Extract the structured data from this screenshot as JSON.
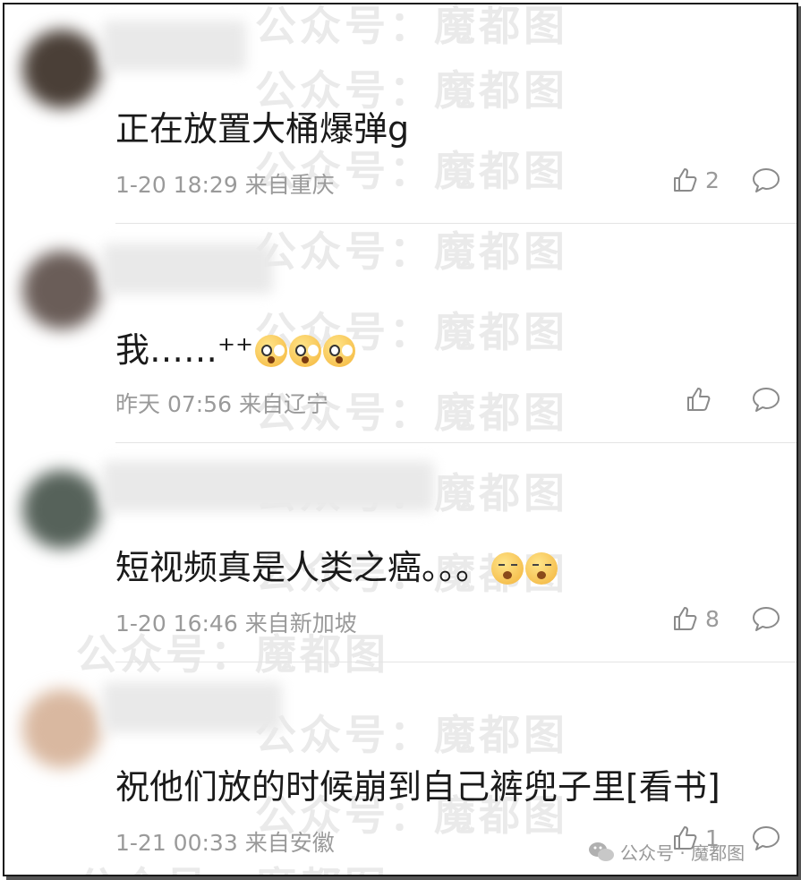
{
  "comments": [
    {
      "text": "正在放置大桶爆弹g",
      "time": "1-20 18:29",
      "location": "来自重庆",
      "likes": "2",
      "emojis": []
    },
    {
      "text": "我……⁺⁺",
      "time": "昨天 07:56",
      "location": "来自辽宁",
      "likes": "",
      "emojis": [
        "shock-emoji",
        "shock-emoji",
        "shock-emoji"
      ]
    },
    {
      "text": "短视频真是人类之癌。。。",
      "time": "1-20 16:46",
      "location": "来自新加坡",
      "likes": "8",
      "emojis": [
        "yawn-emoji",
        "yawn-emoji"
      ]
    },
    {
      "text": "祝他们放的时候崩到自己裤兜子里[看书]",
      "time": "1-21 00:33",
      "location": "来自安徽",
      "likes": "1",
      "emojis": []
    }
  ],
  "watermark": {
    "text": "公众号：魔都图"
  },
  "footer": {
    "icon": "wechat-icon",
    "label": "公众号 · 魔都图"
  },
  "colors": {
    "text": "#1a1a1a",
    "meta": "#9a9a9a",
    "divider": "#e4e4e4"
  }
}
